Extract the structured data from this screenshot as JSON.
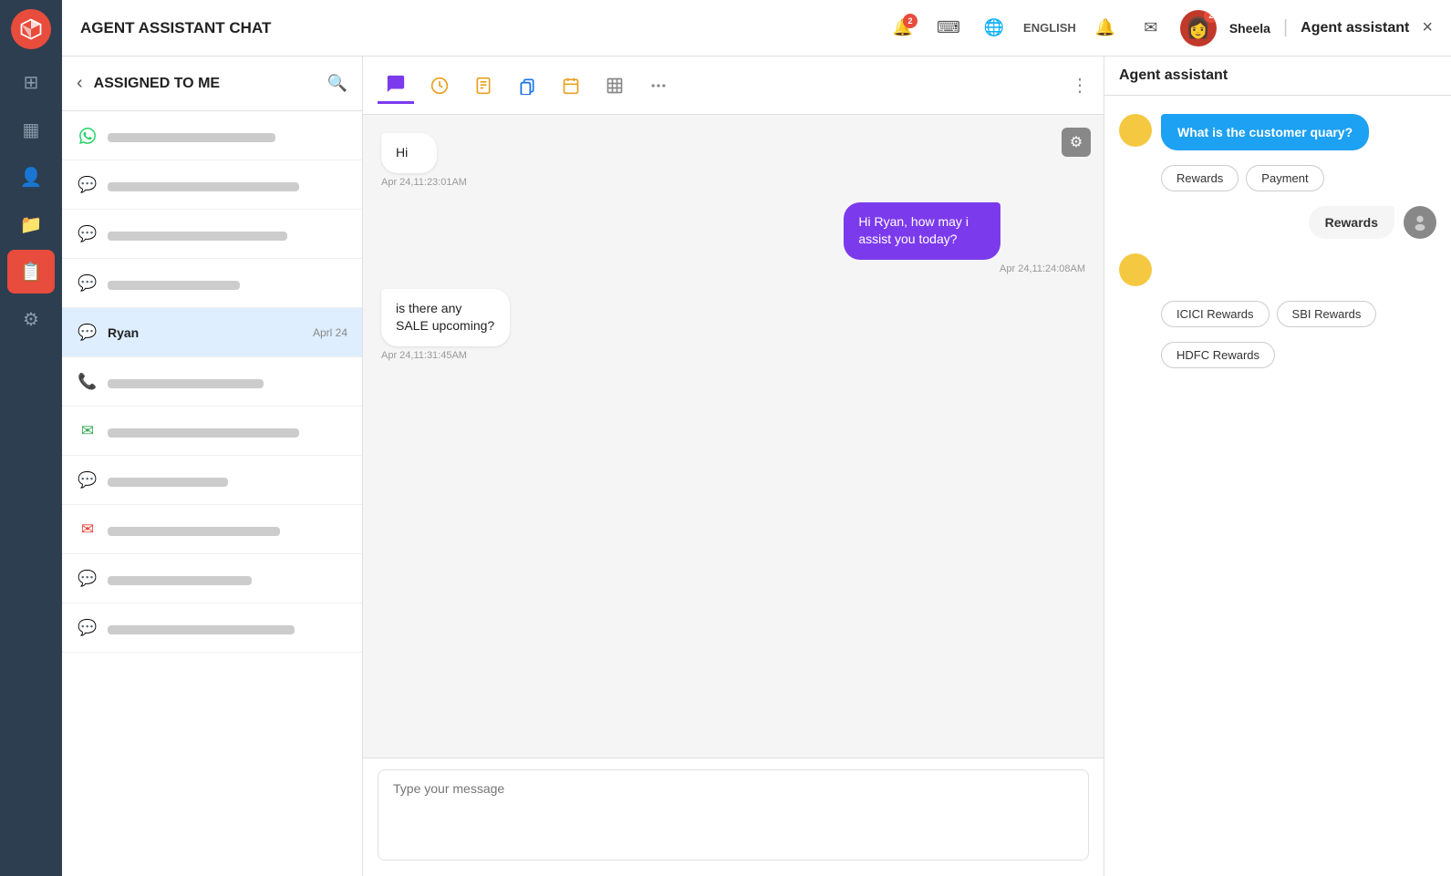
{
  "app": {
    "title": "AGENT ASSISTANT CHAT"
  },
  "header": {
    "notification_count": "2",
    "language": "ENGLISH",
    "user_name": "Sheela",
    "agent_panel_title": "Agent assistant",
    "close_label": "×"
  },
  "nav": {
    "items": [
      {
        "id": "home",
        "icon": "⊞",
        "active": false
      },
      {
        "id": "calendar",
        "icon": "📅",
        "active": false
      },
      {
        "id": "contacts",
        "icon": "👤",
        "active": false
      },
      {
        "id": "files",
        "icon": "📁",
        "active": false
      },
      {
        "id": "reports",
        "icon": "📋",
        "active": true
      },
      {
        "id": "settings",
        "icon": "⚙",
        "active": false
      }
    ]
  },
  "conversations": {
    "header_title": "ASSIGNED TO ME",
    "items": [
      {
        "id": 1,
        "type": "whatsapp",
        "date": "",
        "selected": false
      },
      {
        "id": 2,
        "type": "chat",
        "date": "",
        "selected": false
      },
      {
        "id": 3,
        "type": "chat",
        "date": "",
        "selected": false
      },
      {
        "id": 4,
        "type": "chat",
        "date": "",
        "selected": false
      },
      {
        "id": 5,
        "type": "chat",
        "name": "Ryan",
        "date": "Aprl 24",
        "selected": true
      },
      {
        "id": 6,
        "type": "phone",
        "date": "",
        "selected": false
      },
      {
        "id": 7,
        "type": "email2",
        "date": "",
        "selected": false
      },
      {
        "id": 8,
        "type": "chat",
        "date": "",
        "selected": false
      },
      {
        "id": 9,
        "type": "email",
        "date": "",
        "selected": false
      },
      {
        "id": 10,
        "type": "chat",
        "date": "",
        "selected": false
      },
      {
        "id": 11,
        "type": "chat",
        "date": "",
        "selected": false
      }
    ]
  },
  "chat": {
    "tabs": [
      {
        "id": "chat",
        "icon": "💬",
        "active": true
      },
      {
        "id": "history",
        "icon": "🕐",
        "active": false
      },
      {
        "id": "note",
        "icon": "📝",
        "active": false
      },
      {
        "id": "copy",
        "icon": "📋",
        "active": false
      },
      {
        "id": "calendar",
        "icon": "📅",
        "active": false
      },
      {
        "id": "table",
        "icon": "📊",
        "active": false
      }
    ],
    "messages": [
      {
        "id": 1,
        "side": "left",
        "text": "Hi",
        "time": "Apr 24,11:23:01AM"
      },
      {
        "id": 2,
        "side": "right",
        "text": "Hi Ryan, how may i assist you today?",
        "time": "Apr 24,11:24:08AM"
      },
      {
        "id": 3,
        "side": "left",
        "text": "is there any SALE upcoming?",
        "time": "Apr 24,11:31:45AM"
      }
    ],
    "input_placeholder": "Type your message"
  },
  "agent_assistant": {
    "panel_title": "Agent assistant",
    "messages": [
      {
        "id": 1,
        "from": "bot",
        "text": "What is the customer quary?"
      },
      {
        "id": 2,
        "from": "chips",
        "chips": [
          "Rewards",
          "Payment"
        ]
      },
      {
        "id": 3,
        "from": "user",
        "text": "Rewards"
      },
      {
        "id": 4,
        "from": "bot",
        "text": ""
      },
      {
        "id": 5,
        "from": "chips2",
        "chips": [
          "ICICI Rewards",
          "SBI Rewards",
          "HDFC Rewards"
        ]
      }
    ],
    "chips_row1": [
      "Rewards",
      "Payment"
    ],
    "chips_row2": [
      "ICICI Rewards",
      "SBI Rewards"
    ],
    "chips_row3": [
      "HDFC Rewards"
    ]
  }
}
